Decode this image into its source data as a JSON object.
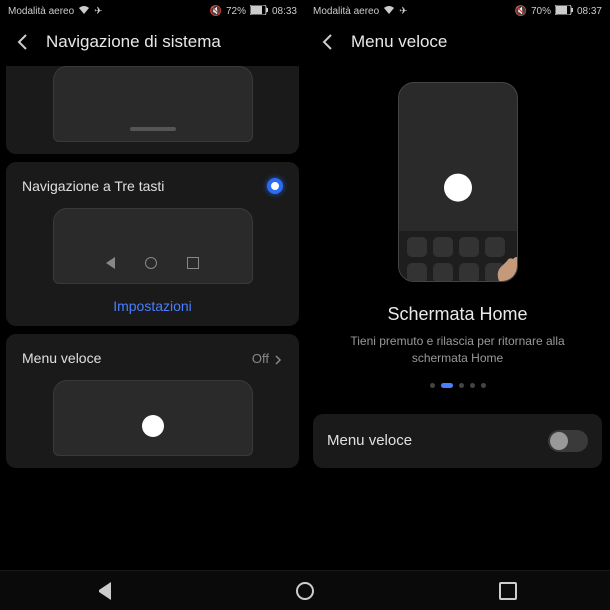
{
  "left": {
    "status": {
      "mode": "Modalità aereo",
      "battery": "72%",
      "time": "08:33"
    },
    "title": "Navigazione di sistema",
    "option_three_keys": "Navigazione a Tre tasti",
    "settings_link": "Impostazioni",
    "option_quick": "Menu veloce",
    "option_quick_state": "Off"
  },
  "right": {
    "status": {
      "mode": "Modalità aereo",
      "battery": "70%",
      "time": "08:37"
    },
    "title": "Menu veloce",
    "subtitle": "Schermata Home",
    "desc": "Tieni premuto e rilascia per ritornare alla schermata Home",
    "toggle_label": "Menu veloce",
    "toggle_on": false
  }
}
